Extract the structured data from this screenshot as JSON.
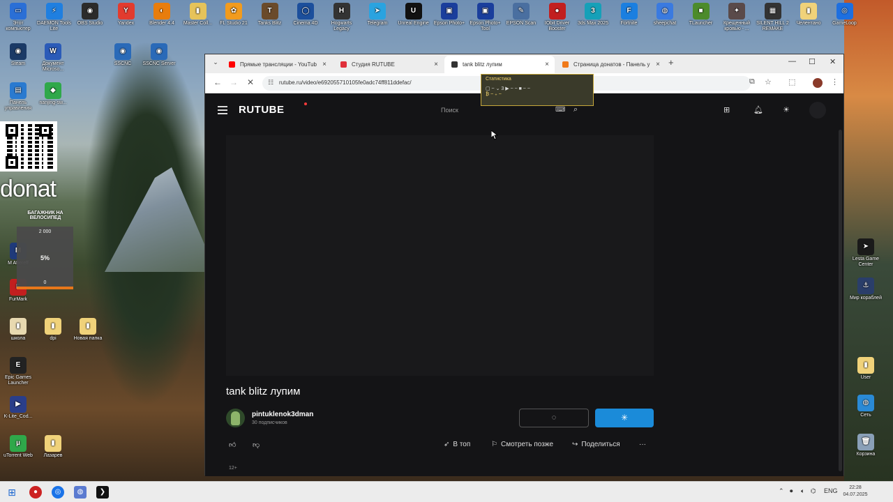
{
  "desktop": {
    "top_icons": [
      {
        "label": "Этот компьютер",
        "color": "#2a6fd6",
        "glyph": "▭"
      },
      {
        "label": "DAEMON Tools Lite",
        "color": "#1f7fe0",
        "glyph": "⚡"
      },
      {
        "label": "OBS Studio",
        "color": "#2b2b2b",
        "glyph": "◉"
      },
      {
        "label": "Yandex",
        "color": "#e23b2e",
        "glyph": "Y"
      },
      {
        "label": "Blender 4.4",
        "color": "#e87d0d",
        "glyph": "◐"
      },
      {
        "label": "Master Coll...",
        "color": "#e6c35a",
        "glyph": "▮"
      },
      {
        "label": "FL Studio 21",
        "color": "#f29b1d",
        "glyph": "✿"
      },
      {
        "label": "Tanks Blitz",
        "color": "#6a4a2a",
        "glyph": "T"
      },
      {
        "label": "Cinema 4D",
        "color": "#1c4f9c",
        "glyph": "◯"
      },
      {
        "label": "Hogwarts Legacy",
        "color": "#333333",
        "glyph": "H"
      },
      {
        "label": "Telegram",
        "color": "#2aa3e0",
        "glyph": "➤"
      },
      {
        "label": "Unreal Engine",
        "color": "#111111",
        "glyph": "U"
      },
      {
        "label": "Epson Photo+",
        "color": "#1a3e9c",
        "glyph": "▣"
      },
      {
        "label": "Epson Photo+ Tool",
        "color": "#1a3e9c",
        "glyph": "▣"
      },
      {
        "label": "EPSON Scan",
        "color": "#4a6fa0",
        "glyph": "✎"
      },
      {
        "label": "IObit Driver Booster",
        "color": "#c21f1f",
        "glyph": "●"
      },
      {
        "label": "3ds Max 2025",
        "color": "#16a0b8",
        "glyph": "3"
      },
      {
        "label": "Fortnite",
        "color": "#1b7fe0",
        "glyph": "F"
      },
      {
        "label": "sheepchat",
        "color": "#3a7ae0",
        "glyph": "◍"
      },
      {
        "label": "TLauncher",
        "color": "#4c8b2b",
        "glyph": "■"
      },
      {
        "label": "Крещенный кровью - ...",
        "color": "#5a4a4a",
        "glyph": "✦"
      },
      {
        "label": "SILENT HILL 2 REMAKE",
        "color": "#333333",
        "glyph": "▦"
      },
      {
        "label": "Челентано",
        "color": "#f0d27a",
        "glyph": "▮"
      },
      {
        "label": "GameLoop",
        "color": "#1d6fe0",
        "glyph": "◎"
      }
    ],
    "left_icons": [
      {
        "label": "Steam",
        "color": "#1b3a66",
        "glyph": "◉"
      },
      {
        "label": "Документ Microso...",
        "color": "#2b5bb8",
        "glyph": "W"
      },
      {
        "label": "SSCNC",
        "color": "#2a6ab8",
        "glyph": "◉"
      },
      {
        "label": "SSCNC Server",
        "color": "#2a6ab8",
        "glyph": "◉"
      },
      {
        "label": "Панель управления",
        "color": "#2a7ad0",
        "glyph": "▤"
      },
      {
        "label": "nanjing-sw...",
        "color": "#2fa84a",
        "glyph": "◆"
      },
      {
        "label": "M Aftereff",
        "color": "#1f3a7a",
        "glyph": "M"
      },
      {
        "label": "FurMark",
        "color": "#c21f1f",
        "glyph": "F"
      },
      {
        "label": "школа",
        "color": "#e8d9b0",
        "glyph": "▮"
      },
      {
        "label": "dpi",
        "color": "#f0d27a",
        "glyph": "▮"
      },
      {
        "label": "Новая папка",
        "color": "#f0d27a",
        "glyph": "▮"
      },
      {
        "label": "Epic Games Launcher",
        "color": "#222222",
        "glyph": "E"
      },
      {
        "label": "K-Lite_Cod...",
        "color": "#2a3e8a",
        "glyph": "▶"
      },
      {
        "label": "uTorrent Web",
        "color": "#2fa84a",
        "glyph": "µ"
      },
      {
        "label": "Лазарев",
        "color": "#f0d27a",
        "glyph": "▮"
      }
    ],
    "right_icons": [
      {
        "label": "Lesta Game Center",
        "color": "#1a1a1a",
        "glyph": "➤"
      },
      {
        "label": "Мир кораблей",
        "color": "#2a3e6a",
        "glyph": "⚓"
      },
      {
        "label": "User",
        "color": "#f0d27a",
        "glyph": "▮"
      },
      {
        "label": "Сеть",
        "color": "#2a8ad6",
        "glyph": "◍"
      },
      {
        "label": "Корзина",
        "color": "#8aa0b8",
        "glyph": "🗑"
      }
    ],
    "donation": {
      "heading": "donat",
      "goal_title": "БАГАЖНИК НА ВЕЛОСИПЕД",
      "goal_top": "2 000",
      "goal_pct": "5%",
      "goal_bottom": "0",
      "progress": 0.05
    }
  },
  "browser": {
    "tabs": [
      {
        "label": "Прямые трансляции - YouTub",
        "fav_color": "#ff0000",
        "active": false
      },
      {
        "label": "Студия RUTUBE",
        "fav_color": "#e0303a",
        "active": false
      },
      {
        "label": "tank blitz лупим",
        "fav_color": "#333333",
        "active": true
      },
      {
        "label": "Страница донатов - Панель у",
        "fav_color": "#f07a1a",
        "active": false
      }
    ],
    "url": "rutube.ru/video/e692055710105fe0adc74ff811ddefac/",
    "stats_tip": {
      "title": "Статистика",
      "row": "▢ ~ ⌄ 3 ▶ ~ ~ ■ ~ ~",
      "row2": "₿ ~ ₊ ~"
    }
  },
  "rutube": {
    "logo": "RUTUBE",
    "search_placeholder": "Поиск",
    "video_title": "tank blitz лупим",
    "channel_name": "pintuklenok3dman",
    "channel_subs": "30 подписчиков",
    "subscribe_loading": "◌",
    "subscribe_spinner": "✳",
    "actions": {
      "top": "В топ",
      "later": "Смотреть позже",
      "share": "Поделиться",
      "more": "···"
    },
    "age_rating": "12+"
  },
  "taskbar": {
    "lang": "ENG",
    "time": "22:28",
    "date": "04.07.2025"
  }
}
